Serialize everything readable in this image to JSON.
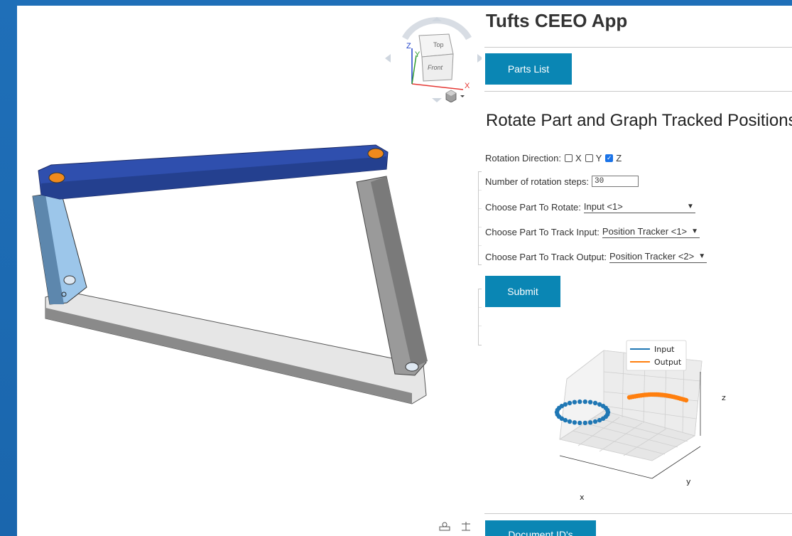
{
  "viewcube": {
    "top_label": "Top",
    "front_label": "Front",
    "x_label": "X",
    "y_label": "Y",
    "z_label": "Z"
  },
  "toolbar_icons": [
    "parts-list-icon",
    "configurations-icon",
    "mate-connectors-icon",
    "named-views-icon",
    "variables-icon",
    "rotate-icon",
    "gif-export-icon",
    "code-icon"
  ],
  "panel": {
    "title": "Tufts CEEO App",
    "parts_list_button": "Parts List",
    "section_title": "Rotate Part and Graph Tracked Positions",
    "rotation_direction_label": "Rotation Direction:",
    "axes": [
      {
        "label": "X",
        "checked": false
      },
      {
        "label": "Y",
        "checked": false
      },
      {
        "label": "Z",
        "checked": true
      }
    ],
    "steps_label": "Number of rotation steps:",
    "steps_value": "30",
    "rotate_part_label": "Choose Part To Rotate:",
    "rotate_part_value": "Input <1>",
    "track_input_label": "Choose Part To Track Input:",
    "track_input_value": "Position Tracker <1>",
    "track_output_label": "Choose Part To Track Output:",
    "track_output_value": "Position Tracker <2>",
    "submit_button": "Submit",
    "document_ids_button": "Document ID's"
  },
  "colors": {
    "accent": "#0a86b4",
    "frame": "#1f6fb8",
    "coupler": "#2f4fae",
    "input_link": "#9cc6ea",
    "series_input": "#1f77b4",
    "series_output": "#ff7f0e"
  },
  "chart_data": {
    "type": "scatter",
    "projection": "3d",
    "xlabel": "x",
    "ylabel": "y",
    "zlabel": "z",
    "legend_position": "top",
    "grid": true,
    "series": [
      {
        "name": "Input",
        "color": "#1f77b4",
        "shape": "circle",
        "points": 30
      },
      {
        "name": "Output",
        "color": "#ff7f0e",
        "shape": "arc",
        "points": 30
      }
    ]
  }
}
